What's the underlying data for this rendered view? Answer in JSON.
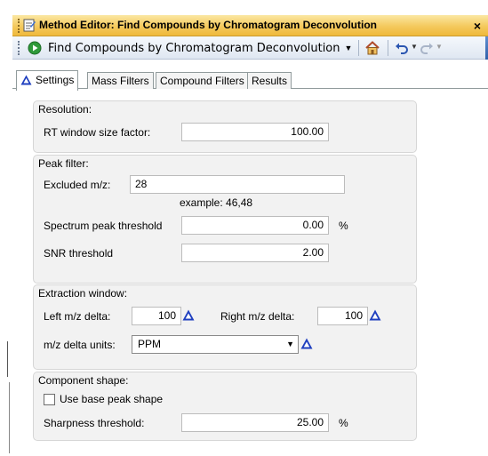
{
  "window": {
    "title": "Method Editor: Find Compounds by Chromatogram Deconvolution",
    "close_label": "×"
  },
  "toolbar": {
    "method_name": "Find Compounds by Chromatogram Deconvolution",
    "method_dropdown_icon": "▼",
    "undo_dd": "▼",
    "redo_dd": "▼"
  },
  "tabs": [
    {
      "label": "Settings",
      "active": true
    },
    {
      "label": "Mass Filters",
      "active": false
    },
    {
      "label": "Compound Filters",
      "active": false
    },
    {
      "label": "Results",
      "active": false
    }
  ],
  "resolution": {
    "group_label": "Resolution:",
    "rt_window_label": "RT window size factor:",
    "rt_window_value": "100.00"
  },
  "peak_filter": {
    "group_label": "Peak filter:",
    "excluded_mz_label": "Excluded m/z:",
    "excluded_mz_value": "28",
    "example_hint": "example: 46,48",
    "spectrum_threshold_label": "Spectrum peak threshold",
    "spectrum_threshold_value": "0.00",
    "spectrum_threshold_unit": "%",
    "snr_label": "SNR threshold",
    "snr_value": "2.00"
  },
  "extraction_window": {
    "group_label": "Extraction window:",
    "left_delta_label": "Left m/z delta:",
    "left_delta_value": "100",
    "right_delta_label": "Right m/z delta:",
    "right_delta_value": "100",
    "units_label": "m/z delta units:",
    "units_value": "PPM",
    "units_arrow": "▼"
  },
  "component_shape": {
    "group_label": "Component shape:",
    "use_base_peak_label": "Use base peak shape",
    "use_base_peak_checked": false,
    "sharpness_label": "Sharpness threshold:",
    "sharpness_value": "25.00",
    "sharpness_unit": "%"
  },
  "colors": {
    "title_gradient": "#f4c95d",
    "toolbar_bg": "#dfe7f2",
    "group_bg": "#f2f2f2",
    "warning_icon_blue": "#1f3fbf"
  }
}
